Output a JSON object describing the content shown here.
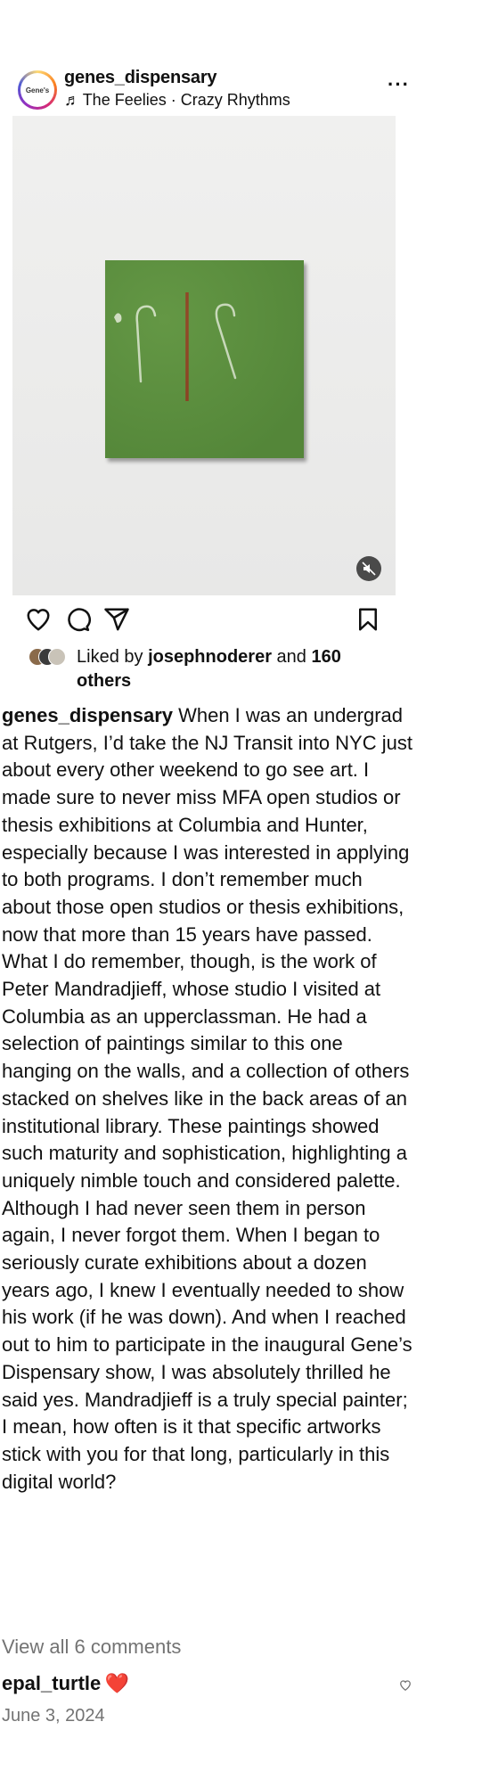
{
  "post": {
    "avatar_text": "Gene's",
    "username": "genes_dispensary",
    "music_note": "♬",
    "music": "The Feelies · Crazy Rhythms",
    "more": "···"
  },
  "actions": {
    "icons": [
      "heart-icon",
      "comment-icon",
      "share-icon",
      "bookmark-icon"
    ]
  },
  "likes": {
    "prefix": "Liked by ",
    "user": "josephnoderer",
    "middle": " and ",
    "count": "160 others"
  },
  "caption": {
    "username": "genes_dispensary",
    "text": " When I was an undergrad at Rutgers, I’d take the NJ Transit into NYC just about every other weekend to go see art. I made sure to never miss MFA open studios or thesis exhibitions at Columbia and Hunter, especially because I was interested in applying to both programs. I don’t remember much about those open studios or thesis exhibitions, now that more than 15 years have passed. What I do remember, though, is the work of Peter Mandradjieff, whose studio I visited at Columbia as an upperclassman. He had a selection of paintings similar to this one hanging on the walls, and a collection of others stacked on shelves like in the back areas of an institutional library. These paintings showed such maturity and sophistication, highlighting a uniquely nimble touch and considered palette. Although I had never seen them in person again, I never forgot them. When I began to seriously curate exhibitions about a dozen years ago, I knew I eventually needed to show his work (if he was down). And when I reached out to him to participate in the inaugural Gene’s Dispensary show, I was absolutely thrilled he said yes. Mandradjieff is a truly special painter; I mean, how often is it that specific artworks stick with you for that long, particularly in this digital world?"
  },
  "comments": {
    "view_all": "View all 6 comments",
    "first": {
      "username": "epal_turtle",
      "emoji": "❤️"
    }
  },
  "date": "June 3, 2024",
  "colors": {
    "canvas_green": "#5b8f3e",
    "stroke_red": "#9a2a1a",
    "muted_text": "#737373"
  }
}
